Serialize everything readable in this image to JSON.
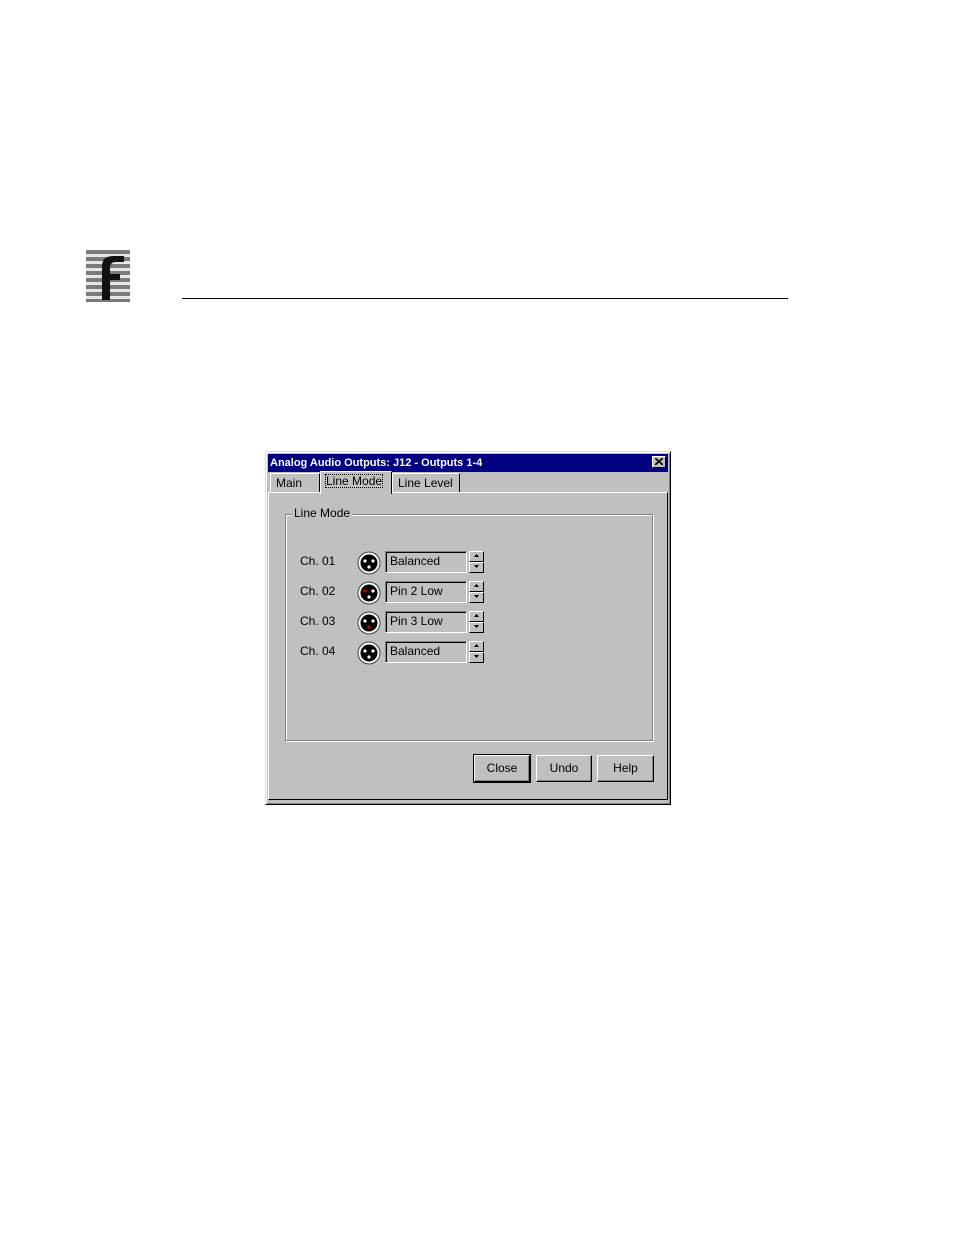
{
  "dialog": {
    "title": "Analog Audio Outputs: J12 - Outputs 1-4",
    "tabs": [
      {
        "label": "Main"
      },
      {
        "label": "Line Mode"
      },
      {
        "label": "Line Level"
      }
    ],
    "active_tab": "Line Mode",
    "group_label": "Line Mode",
    "channels": [
      {
        "label": "Ch. 01",
        "mode": "Balanced"
      },
      {
        "label": "Ch. 02",
        "mode": "Pin 2 Low"
      },
      {
        "label": "Ch. 03",
        "mode": "Pin 3 Low"
      },
      {
        "label": "Ch. 04",
        "mode": "Balanced"
      }
    ],
    "buttons": {
      "close": "Close",
      "undo": "Undo",
      "help": "Help"
    }
  },
  "colors": {
    "titlebar": "#000080",
    "dialog_face": "#c0c0c0",
    "pin_low_marker": "#cc0000"
  }
}
